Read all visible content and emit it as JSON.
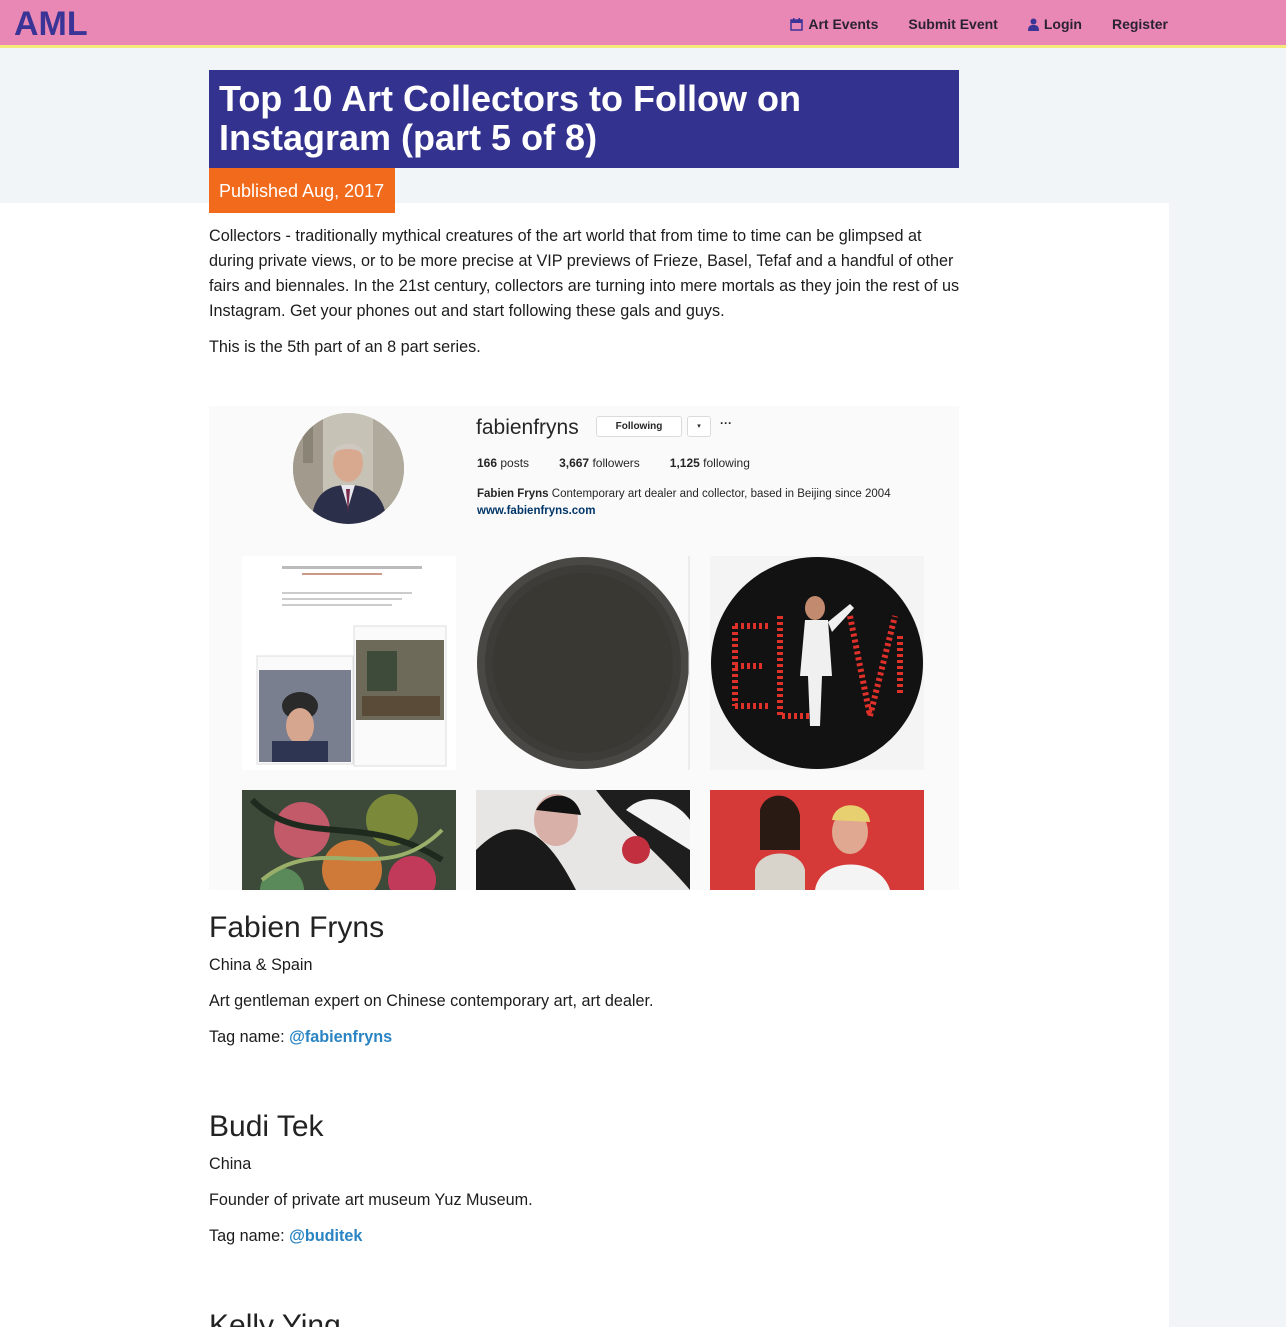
{
  "nav": {
    "brand": "AML",
    "items": [
      {
        "label": "Art Events",
        "icon": "calendar-icon"
      },
      {
        "label": "Submit Event"
      },
      {
        "label": "Login",
        "icon": "user-icon"
      },
      {
        "label": "Register"
      }
    ]
  },
  "article": {
    "title": "Top 10 Art Collectors to Follow on Instagram (part 5 of 8)",
    "published": "Published Aug, 2017",
    "intro": "Collectors - traditionally mythical creatures of the art world that from time to time can be glimpsed at during private views, or to be more precise at VIP previews of Frieze, Basel, Tefaf and a handful of other fairs and biennales. In the 21st century, collectors are turning into mere mortals as they join the rest of us Instagram. Get your phones out and start following these gals and guys.",
    "series_note": "This is the 5th part of an 8 part series."
  },
  "instagram": {
    "username": "fabienfryns",
    "follow_button": "Following",
    "dropdown": "▾",
    "more": "···",
    "posts": "166",
    "posts_label": "posts",
    "followers": "3,667",
    "followers_label": "followers",
    "following": "1,125",
    "following_label": "following",
    "bio_name": "Fabien Fryns",
    "bio_text": "Contemporary art dealer and collector, based in Beijing since 2004",
    "website": "www.fabienfryns.com"
  },
  "collectors": [
    {
      "name": "Fabien Fryns",
      "location": "China & Spain",
      "description": "Art gentleman expert on Chinese contemporary art, art dealer.",
      "tag_label": "Tag name:",
      "tag": "@fabienfryns"
    },
    {
      "name": "Budi Tek",
      "location": "China",
      "description": "Founder of private art museum Yuz Museum.",
      "tag_label": "Tag name:",
      "tag": "@buditek"
    },
    {
      "name": "Kelly Ying"
    }
  ],
  "colors": {
    "navbar": "#ea88b5",
    "brand": "#3a3496",
    "title_bg": "#34328f",
    "published_bg": "#f26a1b",
    "link": "#2a84c3"
  }
}
